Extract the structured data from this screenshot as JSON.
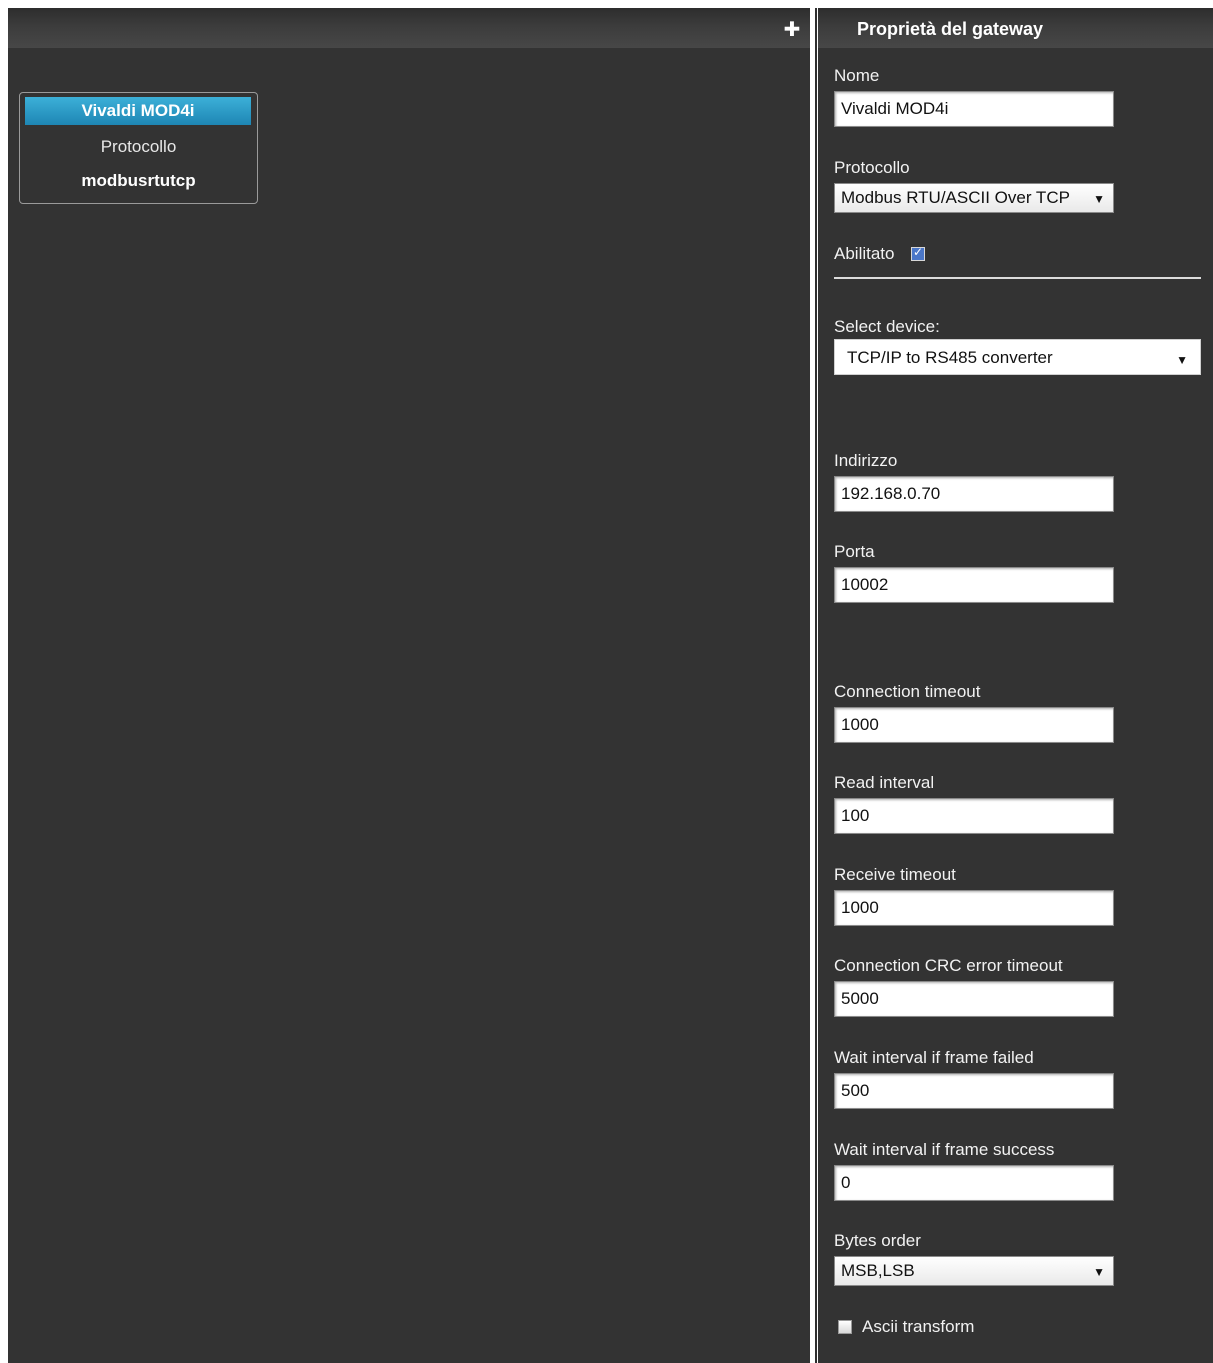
{
  "left": {
    "add_glyph": "✚"
  },
  "card": {
    "name": "Vivaldi MOD4i",
    "protocol_label": "Protocollo",
    "protocol_value": "modbusrtutcp"
  },
  "panel": {
    "title": "Proprietà del gateway",
    "nome_label": "Nome",
    "nome_value": "Vivaldi MOD4i",
    "protocollo_label": "Protocollo",
    "protocollo_value": "Modbus RTU/ASCII Over TCP",
    "abilitato_label": "Abilitato",
    "abilitato_checked": true,
    "select_device_label": "Select device:",
    "select_device_value": "TCP/IP to RS485 converter",
    "indirizzo_label": "Indirizzo",
    "indirizzo_value": "192.168.0.70",
    "porta_label": "Porta",
    "porta_value": "10002",
    "connection_timeout_label": "Connection timeout",
    "connection_timeout_value": "1000",
    "read_interval_label": "Read interval",
    "read_interval_value": "100",
    "receive_timeout_label": "Receive timeout",
    "receive_timeout_value": "1000",
    "crc_timeout_label": "Connection CRC error timeout",
    "crc_timeout_value": "5000",
    "wait_failed_label": "Wait interval if frame failed",
    "wait_failed_value": "500",
    "wait_success_label": "Wait interval if frame success",
    "wait_success_value": "0",
    "bytes_order_label": "Bytes order",
    "bytes_order_value": "MSB,LSB",
    "ascii_transform_label": "Ascii transform",
    "ascii_transform_checked": false
  },
  "colors": {
    "background": "#333333",
    "accent": "#2a9bc9"
  }
}
